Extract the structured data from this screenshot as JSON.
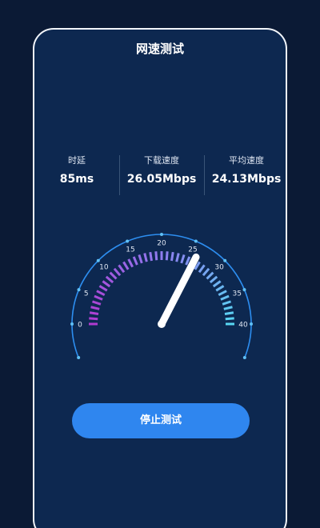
{
  "header": {
    "title": "网速测试"
  },
  "stats": [
    {
      "label": "时延",
      "value": "85ms"
    },
    {
      "label": "下载速度",
      "value": "26.05Mbps"
    },
    {
      "label": "平均速度",
      "value": "24.13Mbps"
    }
  ],
  "gauge": {
    "ticks": [
      "0",
      "5",
      "10",
      "15",
      "20",
      "25",
      "30",
      "35",
      "40"
    ],
    "min": 0,
    "max": 40,
    "value": 26.05,
    "colors": {
      "start": "#b03bd0",
      "mid": "#8f7cf0",
      "end": "#58d6f2",
      "outer_arc": "#2d8ef0",
      "needle": "#ffffff"
    }
  },
  "actions": {
    "stop_label": "停止测试"
  },
  "theme": {
    "background": "#0b1a35",
    "card": "#0d2850",
    "button": "#2f86ef"
  }
}
